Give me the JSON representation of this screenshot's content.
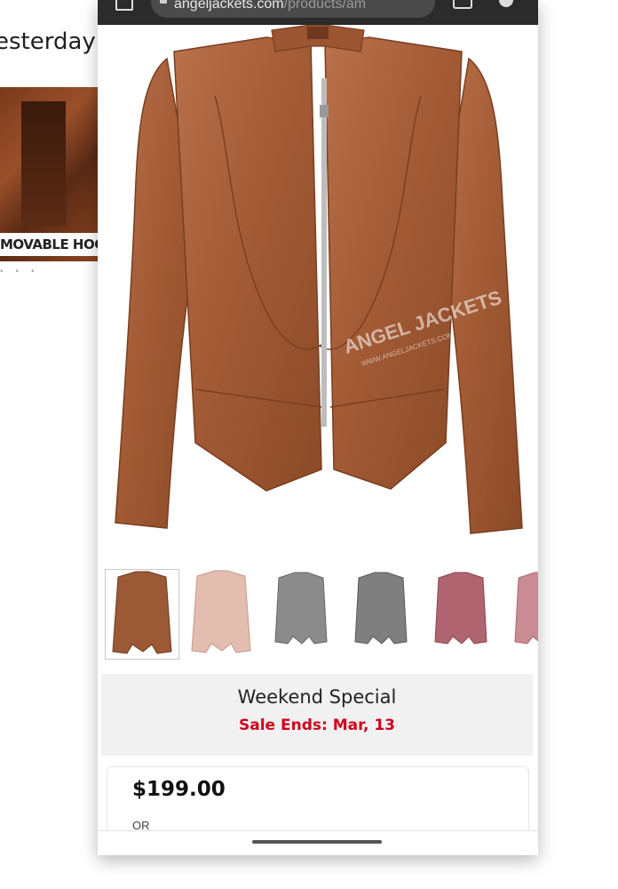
{
  "background_card": {
    "timestamp_text": "esterday",
    "image_caption": "MOVABLE HOOD"
  },
  "browser": {
    "url_host": "angeljackets.com",
    "url_path": "/products/am",
    "icons": [
      "home-icon",
      "lock-icon",
      "tabs-icon",
      "menu-icon"
    ]
  },
  "product": {
    "hero_image_name": "brown-leather-jacket",
    "watermark": "ANGEL JACKETS",
    "watermark_url": "WWW.ANGELJACKETS.COM",
    "thumbnails": [
      {
        "name": "tan-brown",
        "color": "#9b5a35"
      },
      {
        "name": "light-pink",
        "color": "#e2bdb0"
      },
      {
        "name": "gray",
        "color": "#8b8b8b"
      },
      {
        "name": "dark-gray",
        "color": "#7f7f7f"
      },
      {
        "name": "rose",
        "color": "#b06470"
      },
      {
        "name": "pink",
        "color": "#c98c92"
      }
    ]
  },
  "promo": {
    "title": "Weekend Special",
    "sale_text": "Sale Ends: Mar, 13",
    "sale_color": "#d0021b"
  },
  "pricing": {
    "price": "$199.00",
    "or_text": "OR"
  }
}
